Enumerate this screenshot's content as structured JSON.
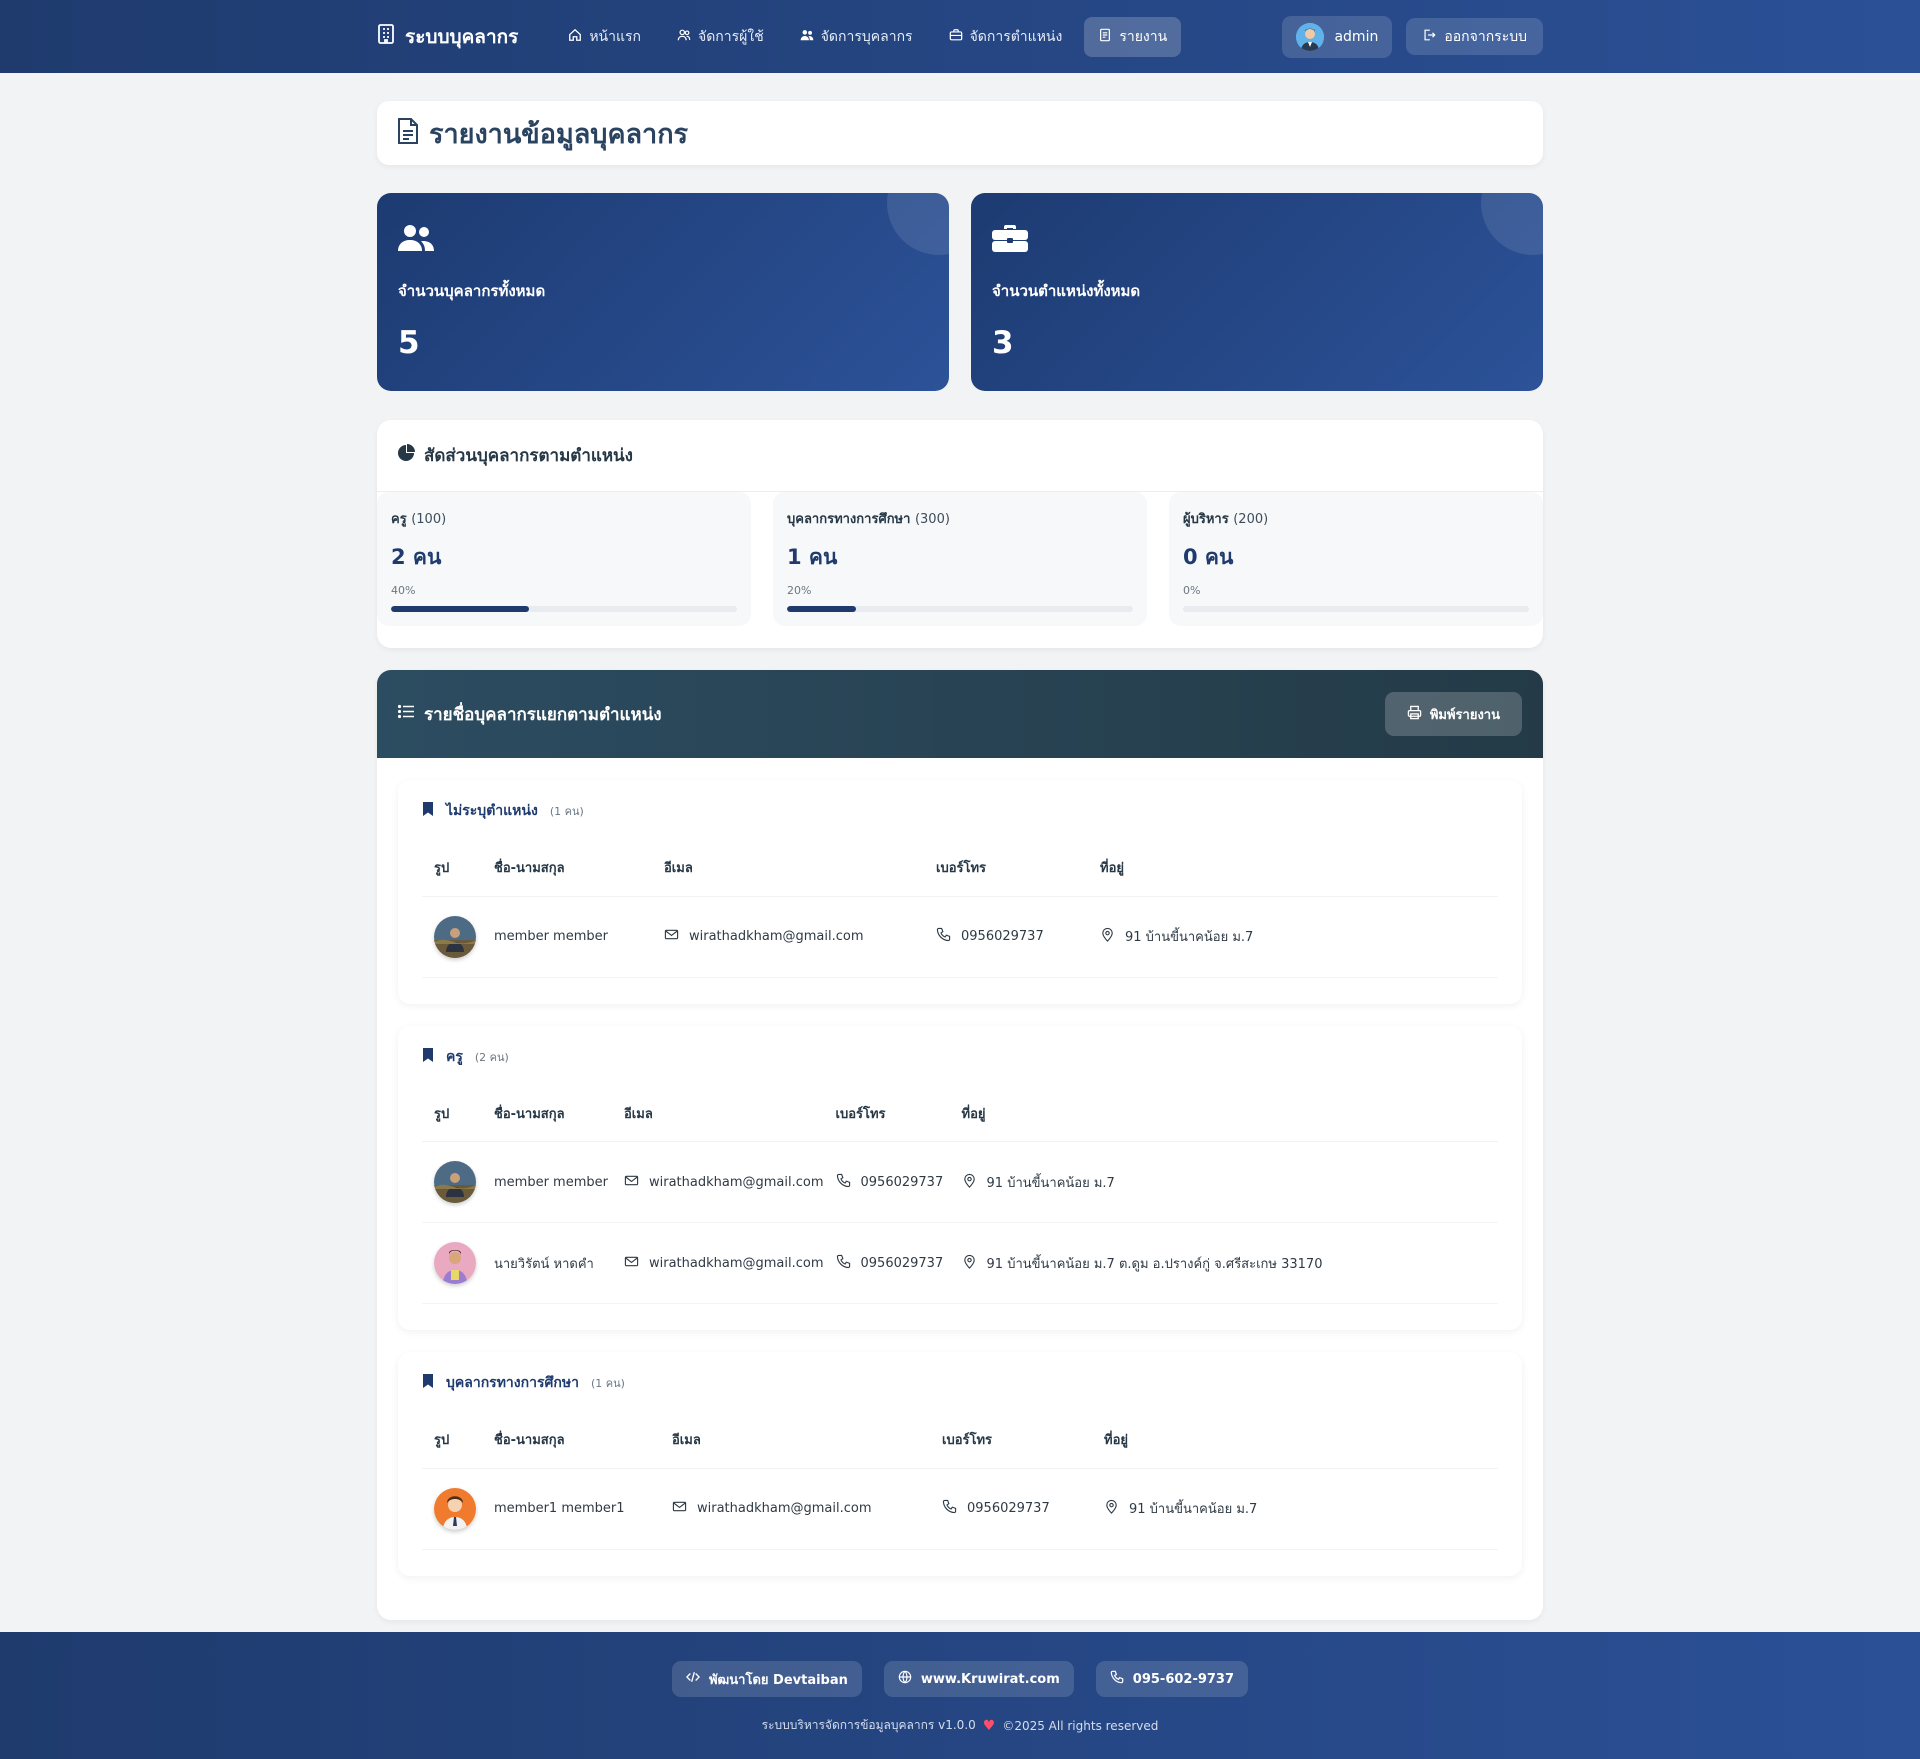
{
  "nav": {
    "brand": "ระบบบุคลากร",
    "items": [
      {
        "label": "หน้าแรก",
        "icon": "home-icon",
        "active": false
      },
      {
        "label": "จัดการผู้ใช้",
        "icon": "users-icon",
        "active": false
      },
      {
        "label": "จัดการบุคลากร",
        "icon": "people-icon",
        "active": false
      },
      {
        "label": "จัดการตำแหน่ง",
        "icon": "briefcase-icon",
        "active": false
      },
      {
        "label": "รายงาน",
        "icon": "report-icon",
        "active": true
      }
    ],
    "user": "admin",
    "logout": "ออกจากระบบ"
  },
  "page": {
    "title": "รายงานข้อมูลบุคลากร"
  },
  "stats": [
    {
      "label": "จำนวนบุคลากรทั้งหมด",
      "value": "5",
      "icon": "people-icon"
    },
    {
      "label": "จำนวนตำแหน่งทั้งหมด",
      "value": "3",
      "icon": "briefcase-icon"
    }
  ],
  "ratio": {
    "title": "สัดส่วนบุคลากรตามตำแหน่ง",
    "items": [
      {
        "name": "ครู",
        "code": "(100)",
        "count": "2 คน",
        "percent": "40%",
        "fill": 0.4
      },
      {
        "name": "บุคลากรทางการศึกษา",
        "code": "(300)",
        "count": "1 คน",
        "percent": "20%",
        "fill": 0.2
      },
      {
        "name": "ผู้บริหาร",
        "code": "(200)",
        "count": "0 คน",
        "percent": "0%",
        "fill": 0
      }
    ]
  },
  "list": {
    "title": "รายชื่อบุคลากรแยกตามตำแหน่ง",
    "print": "พิมพ์รายงาน",
    "columns": [
      "รูป",
      "ชื่อ-นามสกุล",
      "อีเมล",
      "เบอร์โทร",
      "ที่อยู่"
    ],
    "groups": [
      {
        "name": "ไม่ระบุตำแหน่ง",
        "count": "(1 คน)",
        "rows": [
          {
            "name": "member member",
            "email": "wirathadkham@gmail.com",
            "phone": "0956029737",
            "address": "91 บ้านขี้นาคน้อย ม.7",
            "photo": "photo-landscape"
          }
        ]
      },
      {
        "name": "ครู",
        "count": "(2 คน)",
        "rows": [
          {
            "name": "member member",
            "email": "wirathadkham@gmail.com",
            "phone": "0956029737",
            "address": "91 บ้านขี้นาคน้อย ม.7",
            "photo": "photo-landscape"
          },
          {
            "name": "นายวิรัตน์ หาดคำ",
            "email": "wirathadkham@gmail.com",
            "phone": "0956029737",
            "address": "91 บ้านขี้นาคน้อย ม.7 ต.ดูม อ.ปรางค์กู่ จ.ศรีสะเกษ 33170",
            "photo": "photo-person"
          }
        ]
      },
      {
        "name": "บุคลากรทางการศึกษา",
        "count": "(1 คน)",
        "rows": [
          {
            "name": "member1 member1",
            "email": "wirathadkham@gmail.com",
            "phone": "0956029737",
            "address": "91 บ้านขี้นาคน้อย ม.7",
            "photo": "photo-cartoon"
          }
        ]
      }
    ]
  },
  "footer": {
    "dev": "พัฒนาโดย Devtaiban",
    "site": "www.Kruwirat.com",
    "phone": "095-602-9737",
    "copy_left": "ระบบบริหารจัดการข้อมูลบุคลากร v1.0.0",
    "copy_right": "©2025 All rights reserved"
  },
  "colors": {
    "primary": "#1f3b6e",
    "accent": "#2b5096",
    "dark_header": "#2c4c61",
    "heart": "#ff4d6a"
  }
}
